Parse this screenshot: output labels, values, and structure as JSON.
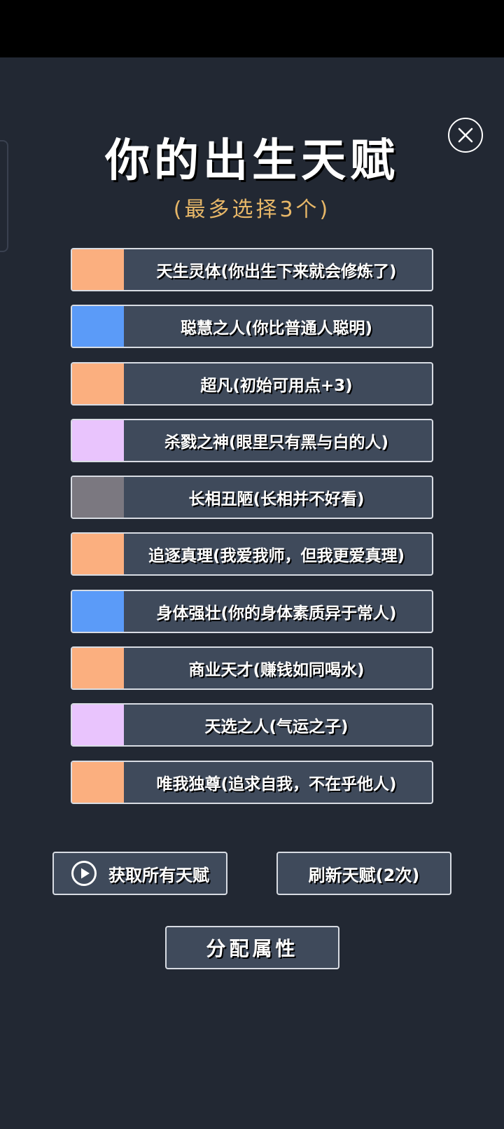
{
  "header": {
    "title": "你的出生天赋",
    "subtitle": "(最多选择3个)",
    "close_icon": "close-icon"
  },
  "talents": [
    {
      "label": "天生灵体(你出生下来就会修炼了)",
      "color": "#fbaf7f"
    },
    {
      "label": "聪慧之人(你比普通人聪明)",
      "color": "#5b9bf8"
    },
    {
      "label": "超凡(初始可用点+3)",
      "color": "#fbaf7f"
    },
    {
      "label": "杀戮之神(眼里只有黑与白的人)",
      "color": "#e9c4fd"
    },
    {
      "label": "长相丑陋(长相并不好看)",
      "color": "#7b7880"
    },
    {
      "label": "追逐真理(我爱我师，但我更爱真理)",
      "color": "#fbaf7f"
    },
    {
      "label": "身体强壮(你的身体素质异于常人)",
      "color": "#5b9bf8"
    },
    {
      "label": "商业天才(赚钱如同喝水)",
      "color": "#fbaf7f"
    },
    {
      "label": "天选之人(气运之子)",
      "color": "#e9c4fd"
    },
    {
      "label": "唯我独尊(追求自我，不在乎他人)",
      "color": "#fbaf7f"
    }
  ],
  "actions": {
    "get_all_label": "获取所有天赋",
    "get_all_icon": "play-circle-icon",
    "refresh_label": "刷新天赋(2次)",
    "allocate_label": "分配属性"
  },
  "colors": {
    "background": "#222833",
    "panel": "#3f4a5b",
    "accent": "#e7b768"
  }
}
